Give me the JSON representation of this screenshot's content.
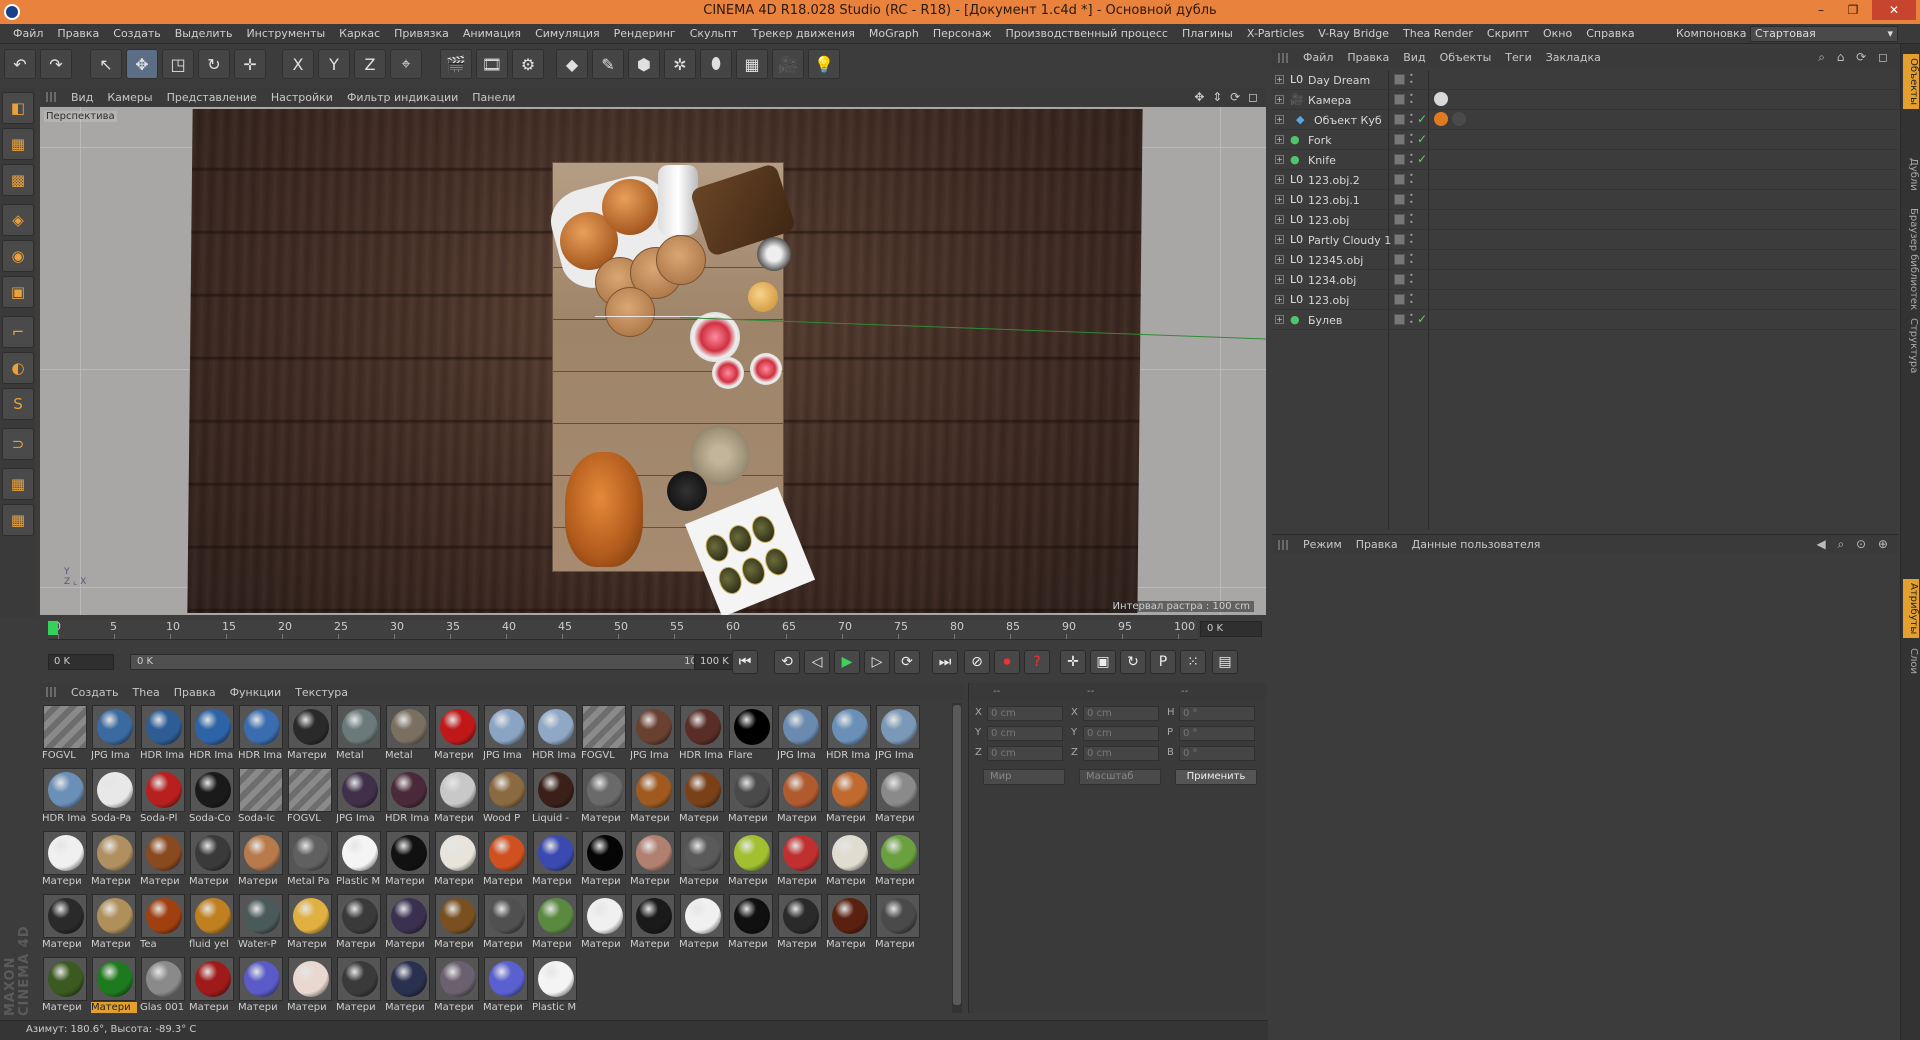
{
  "window": {
    "title": "CINEMA 4D R18.028 Studio (RC - R18) - [Документ 1.c4d *] - Основной дубль",
    "controls": [
      "–",
      "❐",
      "✕"
    ]
  },
  "menubar": {
    "items": [
      "Файл",
      "Правка",
      "Создать",
      "Выделить",
      "Инструменты",
      "Каркас",
      "Привязка",
      "Анимация",
      "Симуляция",
      "Рендеринг",
      "Скульпт",
      "Трекер движения",
      "MoGraph",
      "Персонаж",
      "Производственный процесс",
      "Плагины",
      "X-Particles",
      "V-Ray Bridge",
      "Thea Render",
      "Скрипт",
      "Окно",
      "Справка"
    ],
    "layout_label": "Компоновка",
    "layout_value": "Стартовая"
  },
  "toolbar": {
    "buttons": [
      {
        "name": "undo-button",
        "glyph": "↶"
      },
      {
        "name": "redo-button",
        "glyph": "↷"
      },
      {
        "name": "select-tool-button",
        "glyph": "↖"
      },
      {
        "name": "move-tool-button",
        "glyph": "✥"
      },
      {
        "name": "scale-tool-button",
        "glyph": "◳"
      },
      {
        "name": "rotate-tool-button",
        "glyph": "↻"
      },
      {
        "name": "live-select-button",
        "glyph": "✛"
      },
      {
        "name": "x-axis-button",
        "glyph": "X"
      },
      {
        "name": "y-axis-button",
        "glyph": "Y"
      },
      {
        "name": "z-axis-button",
        "glyph": "Z"
      },
      {
        "name": "coord-system-button",
        "glyph": "⌖"
      },
      {
        "name": "render-view-button",
        "glyph": "🎬"
      },
      {
        "name": "render-picture-button",
        "glyph": "🎞"
      },
      {
        "name": "render-settings-button",
        "glyph": "⚙"
      },
      {
        "name": "cube-button",
        "glyph": "◆"
      },
      {
        "name": "pen-button",
        "glyph": "✎"
      },
      {
        "name": "subdivision-button",
        "glyph": "⬢"
      },
      {
        "name": "array-button",
        "glyph": "✲"
      },
      {
        "name": "deformer-button",
        "glyph": "⬮"
      },
      {
        "name": "floor-button",
        "glyph": "▦"
      },
      {
        "name": "camera-button",
        "glyph": "🎥"
      },
      {
        "name": "light-button",
        "glyph": "💡"
      }
    ]
  },
  "left_tools": [
    "◧",
    "▦",
    "▩",
    "◈",
    "◉",
    "▣",
    "⌐",
    "◐",
    "S",
    "⊃",
    "▦",
    "▦"
  ],
  "viewport": {
    "menu": [
      "Вид",
      "Камеры",
      "Представление",
      "Настройки",
      "Фильтр индикации",
      "Панели"
    ],
    "nav_icons": "✥ ⇕ ⟳ ◻",
    "label": "Перспектива",
    "raster": "Интервал растра : 100 cm",
    "axis_glyph": "Y\nZ ⌞ X"
  },
  "timeline": {
    "ticks": [
      "0",
      "5",
      "10",
      "15",
      "20",
      "25",
      "30",
      "35",
      "40",
      "45",
      "50",
      "55",
      "60",
      "65",
      "70",
      "75",
      "80",
      "85",
      "90",
      "95",
      "100"
    ],
    "current_frame": "0 K",
    "start": "0 K",
    "range_start": "0 K",
    "range_end": "100 K",
    "end": "100 K"
  },
  "transport": {
    "buttons": [
      {
        "name": "goto-start-button",
        "glyph": "⏮"
      },
      {
        "name": "prev-key-button",
        "glyph": "⟲"
      },
      {
        "name": "prev-frame-button",
        "glyph": "◁"
      },
      {
        "name": "play-button",
        "glyph": "▶"
      },
      {
        "name": "next-frame-button",
        "glyph": "▷"
      },
      {
        "name": "next-key-button",
        "glyph": "⟳"
      },
      {
        "name": "goto-end-button",
        "glyph": "⏭"
      },
      {
        "name": "keyframe-button",
        "glyph": "⊘"
      },
      {
        "name": "record-button",
        "glyph": "⏺"
      },
      {
        "name": "autokey-button",
        "glyph": "?"
      },
      {
        "name": "move-key-button",
        "glyph": "✛"
      },
      {
        "name": "scale-key-button",
        "glyph": "▣"
      },
      {
        "name": "rotate-key-button",
        "glyph": "↻"
      },
      {
        "name": "param-key-button",
        "glyph": "P"
      },
      {
        "name": "pla-key-button",
        "glyph": "⁙"
      },
      {
        "name": "timeline-button",
        "glyph": "▤"
      }
    ]
  },
  "materials": {
    "menu": [
      "Создать",
      "Thea",
      "Правка",
      "Функции",
      "Текстура"
    ],
    "rows": [
      [
        {
          "label": "FOGVL",
          "color": "hatched"
        },
        {
          "label": "JPG Ima",
          "color": "#3a6aa0"
        },
        {
          "label": "HDR Ima",
          "color": "#2e5d96"
        },
        {
          "label": "HDR Ima",
          "color": "#2d64a8"
        },
        {
          "label": "HDR Ima",
          "color": "#3a6db0"
        },
        {
          "label": "Матери",
          "color": "#2a2a2a"
        },
        {
          "label": "Metal",
          "color": "#6a7a7a"
        },
        {
          "label": "Metal",
          "color": "#7a7060"
        },
        {
          "label": "Матери",
          "color": "#c01818"
        },
        {
          "label": "JPG Ima",
          "color": "#8aa4c4"
        },
        {
          "label": "HDR Ima",
          "color": "#8fa8c6"
        },
        {
          "label": "FOGVL",
          "color": "hatched"
        },
        {
          "label": "JPG Ima",
          "color": "#6a4030"
        },
        {
          "label": "HDR Ima",
          "color": "#5a2e26"
        },
        {
          "label": "Flare",
          "color": "#000000"
        },
        {
          "label": "JPG Ima",
          "color": "#6a8ab0"
        },
        {
          "label": "HDR Ima",
          "color": "#6a90b8"
        },
        {
          "label": "JPG Ima",
          "color": "#7a98b8"
        }
      ],
      [
        {
          "label": "HDR Ima",
          "color": "#6a90b8"
        },
        {
          "label": "Soda-Pa",
          "color": "#e8e8e8"
        },
        {
          "label": "Soda-Pl",
          "color": "#b82020"
        },
        {
          "label": "Soda-Co",
          "color": "#1a1a1a"
        },
        {
          "label": "Soda-Ic",
          "color": "hatched"
        },
        {
          "label": "FOGVL",
          "color": "hatched"
        },
        {
          "label": "JPG Ima",
          "color": "#40304a"
        },
        {
          "label": "HDR Ima",
          "color": "#4a2a3a"
        },
        {
          "label": "Матери",
          "color": "#c8c8c8"
        },
        {
          "label": "Wood P",
          "color": "#8a6a40"
        },
        {
          "label": "Liquid -",
          "color": "#3a2018"
        },
        {
          "label": "Матери",
          "color": "#6a6a6a"
        },
        {
          "label": "Матери",
          "color": "#a05a20"
        },
        {
          "label": "Матери",
          "color": "#7a4018"
        },
        {
          "label": "Матери",
          "color": "#4a4a4a"
        },
        {
          "label": "Матери",
          "color": "#b05a30"
        },
        {
          "label": "Матери",
          "color": "#c06a30"
        },
        {
          "label": "Матери",
          "color": "#8a8a8a"
        }
      ],
      [
        {
          "label": "Матери",
          "color": "#f0f0f0"
        },
        {
          "label": "Матери",
          "color": "#b09060"
        },
        {
          "label": "Матери",
          "color": "#8a4a20"
        },
        {
          "label": "Матери",
          "color": "#3a3a3a"
        },
        {
          "label": "Матери",
          "color": "#b87a4a"
        },
        {
          "label": "Metal Pa",
          "color": "#606060"
        },
        {
          "label": "Plastic M",
          "color": "#f4f4f4"
        },
        {
          "label": "Матери",
          "color": "#111111"
        },
        {
          "label": "Матери",
          "color": "#e8e4dc"
        },
        {
          "label": "Матери",
          "color": "#d05020"
        },
        {
          "label": "Матери",
          "color": "#3a4ab0"
        },
        {
          "label": "Матери",
          "color": "#050505"
        },
        {
          "label": "Матери",
          "color": "#b08070"
        },
        {
          "label": "Матери",
          "color": "#5a5a5a"
        },
        {
          "label": "Матери",
          "color": "#a0c030"
        },
        {
          "label": "Матери",
          "color": "#c03030"
        },
        {
          "label": "Матери",
          "color": "#e0dcd0"
        },
        {
          "label": "Матери",
          "color": "#6aa040"
        }
      ],
      [
        {
          "label": "Матери",
          "color": "#2a2a2a"
        },
        {
          "label": "Матери",
          "color": "#b0905a"
        },
        {
          "label": "Tea",
          "color": "#a04010"
        },
        {
          "label": "fluid yel",
          "color": "#c08020"
        },
        {
          "label": "Water-P",
          "color": "#4a5a5a"
        },
        {
          "label": "Матери",
          "color": "#e0b040"
        },
        {
          "label": "Матери",
          "color": "#3a3a3a"
        },
        {
          "label": "Матери",
          "color": "#3a3050"
        },
        {
          "label": "Матери",
          "color": "#7a5020"
        },
        {
          "label": "Матери",
          "color": "#505050"
        },
        {
          "label": "Матери",
          "color": "#5a8a40"
        },
        {
          "label": "Матери",
          "color": "#f0f0f0"
        },
        {
          "label": "Матери",
          "color": "#1a1a1a"
        },
        {
          "label": "Матери",
          "color": "#f0f0f0"
        },
        {
          "label": "Матери",
          "color": "#101010"
        },
        {
          "label": "Матери",
          "color": "#2a2a2a"
        },
        {
          "label": "Матери",
          "color": "#5a2010"
        },
        {
          "label": "Матери",
          "color": "#4a4a4a"
        }
      ],
      [
        {
          "label": "Матери",
          "color": "#3a5a20"
        },
        {
          "label": "Матери",
          "color": "#1e7a1e",
          "selected": true
        },
        {
          "label": "Glas 001",
          "color": "#8a8a8a"
        },
        {
          "label": "Матери",
          "color": "#a01a1a"
        },
        {
          "label": "Матери",
          "color": "#5a5ac8"
        },
        {
          "label": "Матери",
          "color": "#e8d8d0"
        },
        {
          "label": "Матери",
          "color": "#3a3a3a"
        },
        {
          "label": "Матери",
          "color": "#2a3050"
        },
        {
          "label": "Матери",
          "color": "#6a6070"
        },
        {
          "label": "Матери",
          "color": "#5a60d0"
        },
        {
          "label": "Plastic M",
          "color": "#f4f4f4"
        }
      ]
    ]
  },
  "coordinates": {
    "head": [
      "--",
      "--",
      "--"
    ],
    "rows": [
      {
        "a": "X",
        "v1": "0 cm",
        "b": "X",
        "v2": "0 cm",
        "c": "H",
        "v3": "0 °"
      },
      {
        "a": "Y",
        "v1": "0 cm",
        "b": "Y",
        "v2": "0 cm",
        "c": "P",
        "v3": "0 °"
      },
      {
        "a": "Z",
        "v1": "0 cm",
        "b": "Z",
        "v2": "0 cm",
        "c": "B",
        "v3": "0 °"
      }
    ],
    "mode1": "Мир",
    "mode2": "Масштаб",
    "apply": "Применить"
  },
  "status": {
    "text": "Азимут: 180.6°, Высота: -89.3°  C"
  },
  "logo": "MAXON CINEMA 4D",
  "objects": {
    "menu": [
      "Файл",
      "Правка",
      "Вид",
      "Объекты",
      "Теги",
      "Закладка"
    ],
    "icons": "⌕ ⌂ ⟳ ◻",
    "items": [
      {
        "name": "Day Dream",
        "icon": "L0",
        "check": false,
        "tags": []
      },
      {
        "name": "Камера",
        "icon": "🎥",
        "check": false,
        "tags": [
          "#d8d8d8"
        ]
      },
      {
        "name": "Объект Куб",
        "icon": "◆",
        "check": true,
        "tags": [
          "#e07a20",
          "#4a4a4a"
        ],
        "indent": true
      },
      {
        "name": "Fork",
        "icon": "●",
        "check": true,
        "tags": []
      },
      {
        "name": "Knife",
        "icon": "●",
        "check": true,
        "tags": []
      },
      {
        "name": "123.obj.2",
        "icon": "L0",
        "check": false,
        "tags": []
      },
      {
        "name": "123.obj.1",
        "icon": "L0",
        "check": false,
        "tags": []
      },
      {
        "name": "123.obj",
        "icon": "L0",
        "check": false,
        "tags": []
      },
      {
        "name": "Partly Cloudy 1",
        "icon": "L0",
        "check": false,
        "tags": []
      },
      {
        "name": "12345.obj",
        "icon": "L0",
        "check": false,
        "tags": []
      },
      {
        "name": "1234.obj",
        "icon": "L0",
        "check": false,
        "tags": []
      },
      {
        "name": "123.obj",
        "icon": "L0",
        "check": false,
        "tags": []
      },
      {
        "name": "Булев",
        "icon": "●",
        "check": true,
        "tags": []
      }
    ]
  },
  "attributes": {
    "menu": [
      "Режим",
      "Правка",
      "Данные пользователя"
    ],
    "icons": "◀ ⌕ ⊙ ⊕"
  },
  "right_tabs": [
    {
      "label": "Объекты",
      "active": true
    },
    {
      "label": "Дубли",
      "active": false
    },
    {
      "label": "Браузер библиотек",
      "active": false
    },
    {
      "label": "Структура",
      "active": false
    },
    {
      "label": "Атрибуты",
      "active": true
    },
    {
      "label": "Слои",
      "active": false
    }
  ]
}
